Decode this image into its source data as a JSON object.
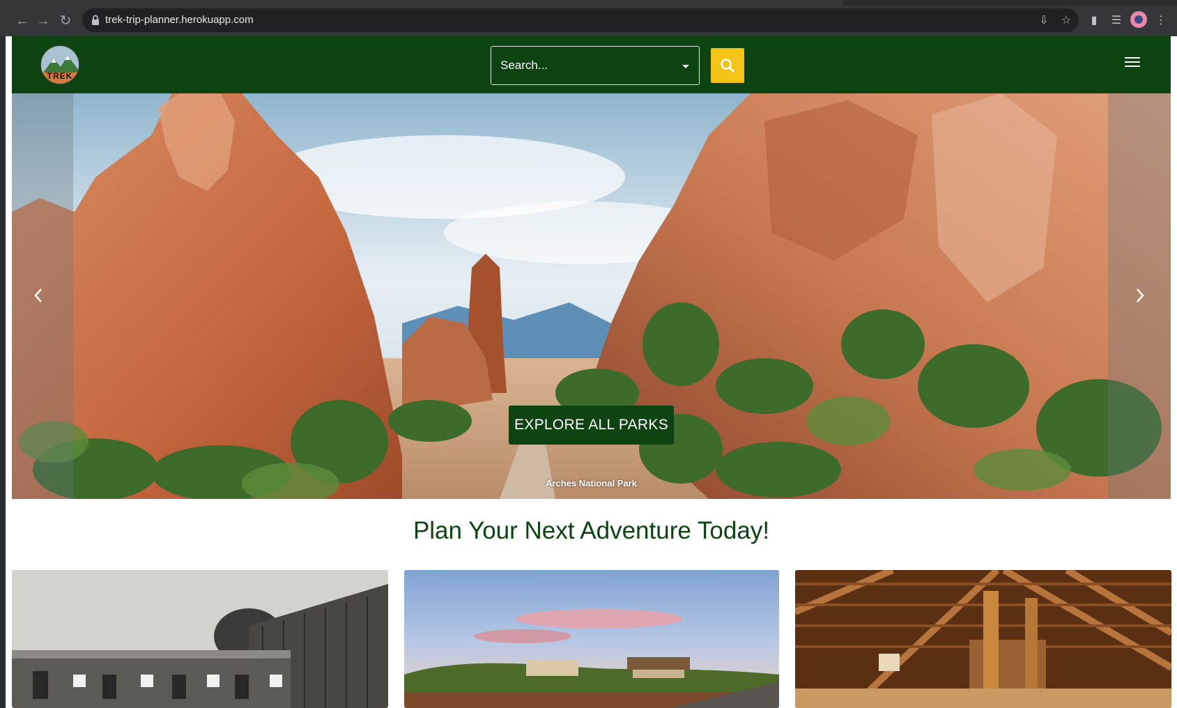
{
  "browser": {
    "url": "trek-trip-planner.herokuapp.com",
    "nav_icons": [
      "back-arrow-icon",
      "forward-arrow-icon",
      "reload-icon"
    ],
    "toolbar_icons": [
      "install-icon",
      "star-icon",
      "extensions-icon",
      "media-icon",
      "avatar",
      "more-icon"
    ]
  },
  "navbar": {
    "logo_text": "TREK",
    "search_placeholder": "Search...",
    "brand_color": "#0d4311",
    "accent_color": "#f3c315"
  },
  "hero": {
    "button_label": "EXPLORE ALL PARKS",
    "caption": "Arches National Park"
  },
  "main": {
    "headline": "Plan Your Next Adventure Today!"
  }
}
